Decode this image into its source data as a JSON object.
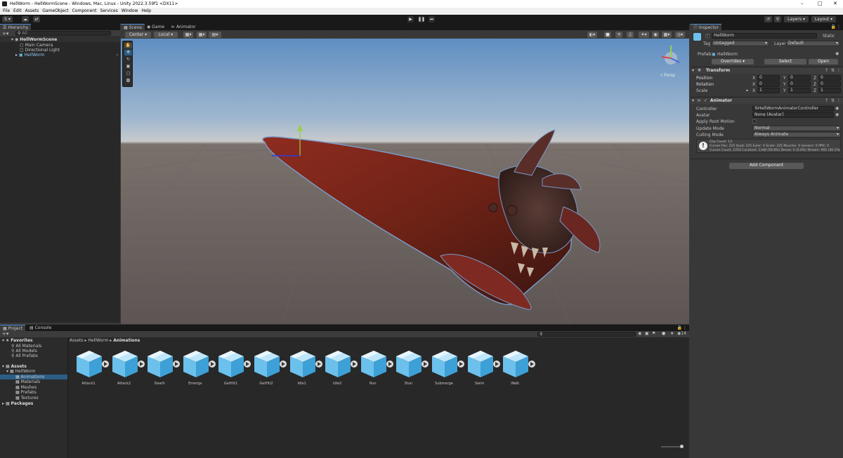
{
  "window": {
    "title": "HellWorm - HellWormScene - Windows, Mac, Linux - Unity 2022.3.59f1 <DX11>"
  },
  "menu": [
    "File",
    "Edit",
    "Assets",
    "GameObject",
    "Component",
    "Services",
    "Window",
    "Help"
  ],
  "toolbar": {
    "account": "S ▾",
    "layers": "Layers",
    "layout": "Layout"
  },
  "hierarchy": {
    "tab": "Hierarchy",
    "search_placeholder": "All",
    "scene": "HellWormScene",
    "items": [
      "Main Camera",
      "Directional Light",
      "HellWorm"
    ]
  },
  "scene_view": {
    "tabs": [
      "Scene",
      "Game",
      "Animator"
    ],
    "pivot": "Center",
    "space": "Local",
    "persp": "< Persp"
  },
  "inspector": {
    "tab": "Inspector",
    "object_name": "HellWorm",
    "static_label": "Static",
    "tag_label": "Tag",
    "tag_value": "Untagged",
    "layer_label": "Layer",
    "layer_value": "Default",
    "prefab_label": "Prefab",
    "prefab_value": "HellWorm",
    "overrides": "Overrides",
    "select": "Select",
    "open": "Open",
    "transform": {
      "title": "Transform",
      "position_label": "Position",
      "position": [
        "0",
        "0",
        "0"
      ],
      "rotation_label": "Rotation",
      "rotation": [
        "0",
        "0",
        "0"
      ],
      "scale_label": "Scale",
      "scale": [
        "1",
        "1",
        "1"
      ]
    },
    "animator": {
      "title": "Animator",
      "controller_label": "Controller",
      "controller": "HellWormAnimatorController",
      "avatar_label": "Avatar",
      "avatar": "None (Avatar)",
      "root_motion_label": "Apply Root Motion",
      "update_label": "Update Mode",
      "update": "Normal",
      "culling_label": "Culling Mode",
      "culling": "Always Animate",
      "info1": "Clip Count: 13",
      "info2": "Curves Pos: 225 Quat: 225 Euler: 0 Scale: 225 Muscles: 0 Generic: 0 PPtr: 0",
      "info3": "Curves Count: 2250 Constant: 1348 (59.8%) Dense: 0 (0.0%) Stream: 902 (40.1%)"
    },
    "add_component": "Add Component"
  },
  "project": {
    "tabs": [
      "Project",
      "Console"
    ],
    "favorites": "Favorites",
    "fav_items": [
      "All Materials",
      "All Models",
      "All Prefabs"
    ],
    "assets_label": "Assets",
    "tree": [
      "HellWorm",
      "Animations",
      "Materials",
      "Meshes",
      "Prefabs",
      "Textures"
    ],
    "packages": "Packages",
    "breadcrumb": [
      "Assets",
      "HellWorm",
      "Animations"
    ],
    "hidden_count": "14",
    "assets": [
      "Attack1",
      "Attack2",
      "Death",
      "Emerge",
      "GetHit1",
      "GetHit2",
      "Idle1",
      "Idle2",
      "Run",
      "Stun",
      "Submerge",
      "Swim",
      "Walk"
    ]
  },
  "colors": {
    "accent": "#2c5d87",
    "cube": "#6cc0ec",
    "worm": "#8a2418"
  }
}
